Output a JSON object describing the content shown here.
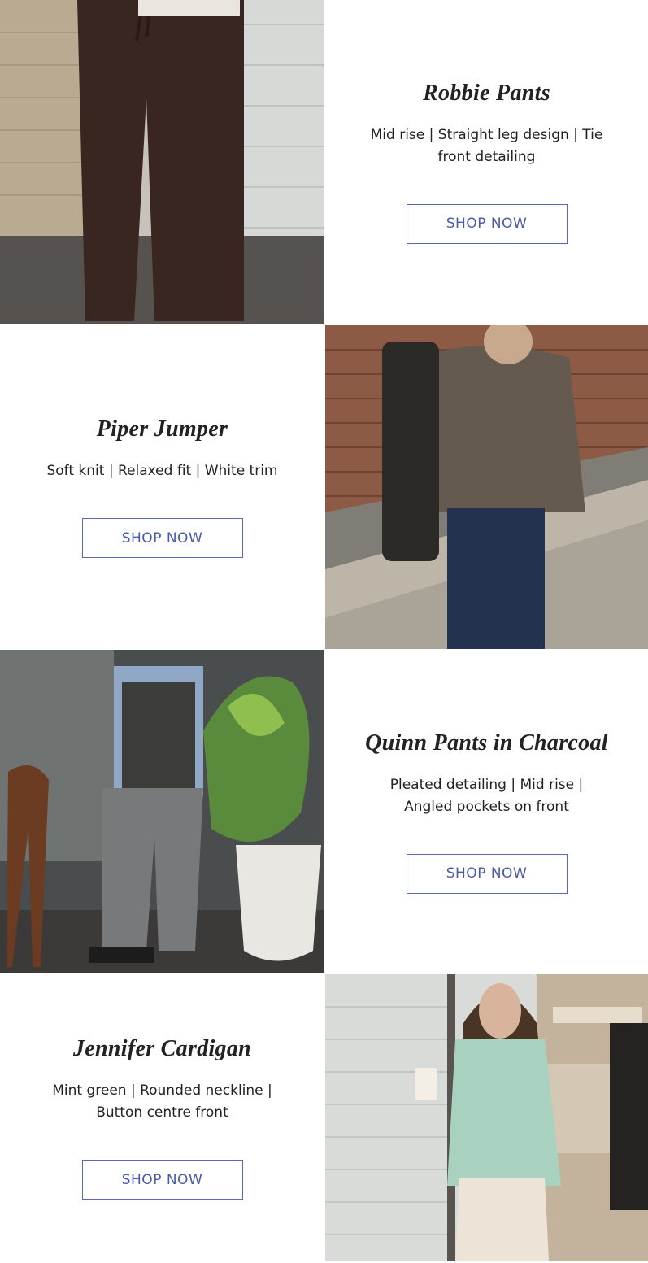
{
  "products": [
    {
      "title": "Robbie Pants",
      "description": "Mid rise | Straight leg design | Tie front detailing",
      "cta": "SHOP NOW"
    },
    {
      "title": "Piper Jumper",
      "description": "Soft knit | Relaxed fit | White trim",
      "cta": "SHOP NOW"
    },
    {
      "title": "Quinn Pants in Charcoal",
      "description": "Pleated detailing | Mid rise | Angled pockets on front",
      "cta": "SHOP NOW"
    },
    {
      "title": "Jennifer Cardigan",
      "description": "Mint green | Rounded neckline | Button centre front",
      "cta": "SHOP NOW"
    }
  ],
  "colors": {
    "button_border": "#5a66b8",
    "button_text": "#4b59ad",
    "title_text": "#222222"
  }
}
